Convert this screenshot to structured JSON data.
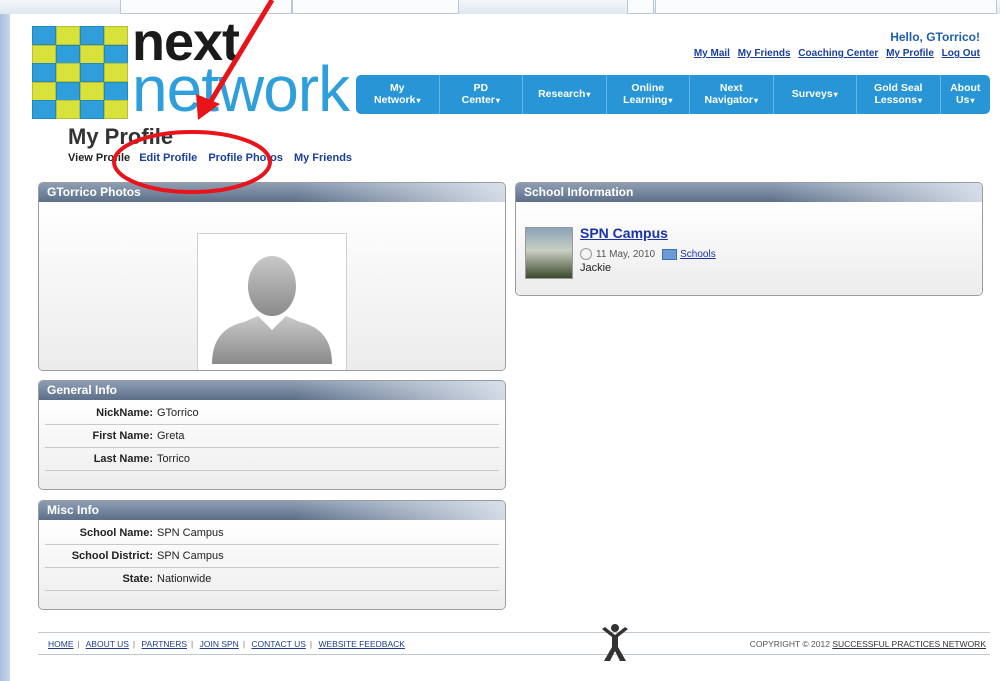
{
  "browser": {
    "tabs": [
      "",
      "",
      "",
      ""
    ]
  },
  "logo": {
    "next": "next",
    "network": "network"
  },
  "header": {
    "greeting": "Hello, GTorrico!",
    "links": [
      "My Mail",
      "My Friends",
      "Coaching Center",
      "My Profile",
      "Log Out"
    ]
  },
  "nav": [
    {
      "line1": "My",
      "line2": "Network"
    },
    {
      "line1": "PD",
      "line2": "Center"
    },
    {
      "line1": "Research",
      "line2": ""
    },
    {
      "line1": "Online",
      "line2": "Learning"
    },
    {
      "line1": "Next",
      "line2": "Navigator"
    },
    {
      "line1": "Surveys",
      "line2": ""
    },
    {
      "line1": "Gold Seal",
      "line2": "Lessons"
    },
    {
      "line1": "About",
      "line2": "Us"
    }
  ],
  "profile": {
    "title": "My Profile",
    "tabs": [
      "View Profile",
      "Edit Profile",
      "Profile Photos",
      "My Friends"
    ]
  },
  "photos_panel": {
    "title": "GTorrico Photos"
  },
  "general_info": {
    "title": "General Info",
    "rows": [
      {
        "label": "NickName:",
        "value": "GTorrico"
      },
      {
        "label": "First Name:",
        "value": "Greta"
      },
      {
        "label": "Last Name:",
        "value": "Torrico"
      }
    ]
  },
  "misc_info": {
    "title": "Misc Info",
    "rows": [
      {
        "label": "School Name:",
        "value": "SPN Campus"
      },
      {
        "label": "School District:",
        "value": "SPN Campus"
      },
      {
        "label": "State:",
        "value": "Nationwide"
      }
    ]
  },
  "school_info": {
    "title": "School Information",
    "name": "SPN Campus",
    "date": "11 May, 2010",
    "category": "Schools",
    "author": "Jackie"
  },
  "footer": {
    "links": [
      "HOME",
      "ABOUT US",
      "PARTNERS",
      "JOIN SPN",
      "CONTACT US",
      "WEBSITE FEEDBACK"
    ],
    "copyright_prefix": "COPYRIGHT © 2012",
    "copyright_link": "SUCCESSFUL PRACTICES NETWORK"
  },
  "colors": {
    "nav": "#2795d6",
    "annotation": "#e8141a",
    "link": "#1a3f9a"
  }
}
